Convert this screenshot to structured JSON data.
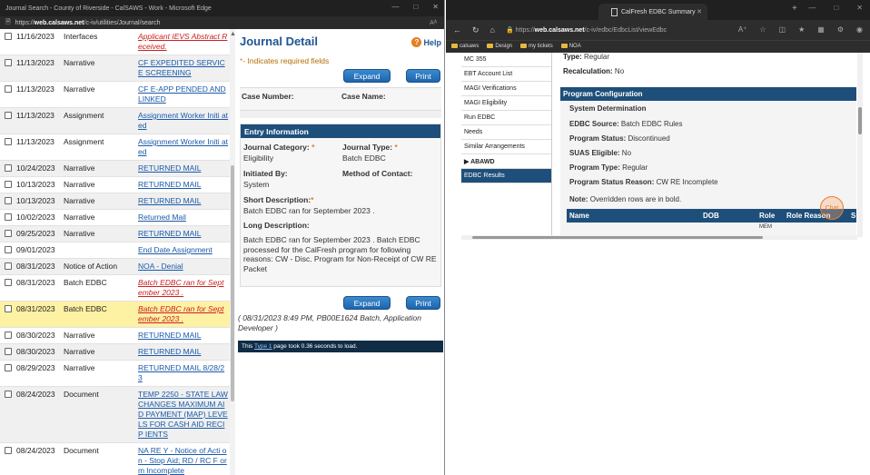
{
  "left_window": {
    "title": "Journal Search - County of Riverside - CalSAWS - Work - Microsoft Edge",
    "url_prefix": "https://",
    "url_domain": "web.calsaws.net",
    "url_path": "/c-iv/utilities/Journal/search",
    "reader_icon": "Aᴬ",
    "journal_rows": [
      {
        "date": "11/16/2023",
        "type": "Interfaces",
        "desc": "Applicant IEVS Abstract Received.",
        "style": "red"
      },
      {
        "date": "11/13/2023",
        "type": "Narrative",
        "desc": "CF EXPEDITED SERVICE SCREENING",
        "style": "link"
      },
      {
        "date": "11/13/2023",
        "type": "Narrative",
        "desc": "CF E-APP PENDED AND LINKED",
        "style": "link"
      },
      {
        "date": "11/13/2023",
        "type": "Assignment",
        "desc": "Assignment Worker Initi ated",
        "style": "link"
      },
      {
        "date": "11/13/2023",
        "type": "Assignment",
        "desc": "Assignment Worker Initi ated",
        "style": "link"
      },
      {
        "date": "10/24/2023",
        "type": "Narrative",
        "desc": "RETURNED MAIL",
        "style": "link"
      },
      {
        "date": "10/13/2023",
        "type": "Narrative",
        "desc": "RETURNED MAIL",
        "style": "link"
      },
      {
        "date": "10/13/2023",
        "type": "Narrative",
        "desc": "RETURNED MAIL",
        "style": "link"
      },
      {
        "date": "10/02/2023",
        "type": "Narrative",
        "desc": "Returned Mail",
        "style": "link"
      },
      {
        "date": "09/25/2023",
        "type": "Narrative",
        "desc": "RETURNED MAIL",
        "style": "link"
      },
      {
        "date": "09/01/2023",
        "type": "",
        "desc": "End Date Assignment",
        "style": "link"
      },
      {
        "date": "08/31/2023",
        "type": "Notice of Action",
        "desc": "NOA - Denial",
        "style": "link"
      },
      {
        "date": "08/31/2023",
        "type": "Batch EDBC",
        "desc": "Batch EDBC ran for Sept ember 2023 .",
        "style": "red"
      },
      {
        "date": "08/31/2023",
        "type": "Batch EDBC",
        "desc": "Batch EDBC ran for Sept ember 2023 .",
        "style": "red"
      },
      {
        "date": "08/30/2023",
        "type": "Narrative",
        "desc": "RETURNED MAIL",
        "style": "link"
      },
      {
        "date": "08/30/2023",
        "type": "Narrative",
        "desc": "RETURNED MAIL",
        "style": "link"
      },
      {
        "date": "08/29/2023",
        "type": "Narrative",
        "desc": "RETURNED MAIL 8/28/2 3",
        "style": "link"
      },
      {
        "date": "08/24/2023",
        "type": "Document",
        "desc": "TEMP 2250 - STATE LAW CHANGES MAXIMUM AI D PAYMENT (MAP) LEVE LS FOR CASH AID RECIP IENTS",
        "style": "link"
      },
      {
        "date": "08/24/2023",
        "type": "Document",
        "desc": "NA RE Y - Notice of Acti on - Stop Aid; RD / RC F orm Incomplete",
        "style": "link"
      }
    ]
  },
  "journal_detail": {
    "title": "Journal Detail",
    "help": "Help",
    "required_note": "- Indicates required fields",
    "required_star": "*",
    "expand_label": "Expand",
    "print_label": "Print",
    "case_number_label": "Case Number:",
    "case_name_label": "Case Name:",
    "entry_header": "Entry Information",
    "journal_category_label": "Journal Category:",
    "journal_category_value": "Eligibility",
    "journal_type_label": "Journal Type:",
    "journal_type_value": "Batch EDBC",
    "initiated_by_label": "Initiated By:",
    "initiated_by_value": "System",
    "method_label": "Method of Contact:",
    "short_desc_label": "Short Description:",
    "short_desc_value": "Batch EDBC ran for September 2023 .",
    "long_desc_label": "Long Description:",
    "long_desc_value": "Batch EDBC ran for September 2023 . Batch EDBC processed for the CalFresh  program for following reasons:  CW - Disc. Program for Non-Receipt of CW RE Packet",
    "footer_text": "( 08/31/2023 8:49 PM, PB00E1624 Batch, Application Developer )",
    "load_prefix": "This ",
    "load_link": "Type 1",
    "load_suffix": " page took 0.36 seconds to load."
  },
  "right_window": {
    "tab_title": "CalFresh EDBC Summary",
    "url_prefix": "https://",
    "url_domain": "web.calsaws.net",
    "url_path": "/c-iv/edbc/EdbcList/viewEdbc",
    "bookmarks": [
      "calsaws",
      "Design",
      "my tickets",
      "NOA"
    ],
    "side_items": [
      "MC 355",
      "EBT Account List",
      "MAGI Verifications",
      "MAGI Eligibility",
      "Run EDBC",
      "Needs",
      "Similar Arrangements",
      "▶ ABAWD",
      "EDBC Results"
    ],
    "type_label": "Type:",
    "type_value": "Regular",
    "recalc_label": "Recalculation:",
    "recalc_value": "No",
    "program_config_header": "Program Configuration",
    "system_determination": "System Determination",
    "edbc_source_label": "EDBC Source:",
    "edbc_source_value": "Batch EDBC Rules",
    "program_status_label": "Program Status:",
    "program_status_value": "Discontinued",
    "suas_label": "SUAS Eligible:",
    "suas_value": "No",
    "program_type_label": "Program Type:",
    "program_type_value": "Regular",
    "status_reason_label": "Program Status Reason:",
    "status_reason_value": "CW RE Incomplete",
    "note_label": "Note:",
    "note_value": "Overridden rows are in bold.",
    "table_headers": {
      "name": "Name",
      "dob": "DOB",
      "role": "Role",
      "role_reason": "Role Reason",
      "s": "S"
    },
    "table_row_role": "MEM",
    "chat_label": "Chat"
  }
}
